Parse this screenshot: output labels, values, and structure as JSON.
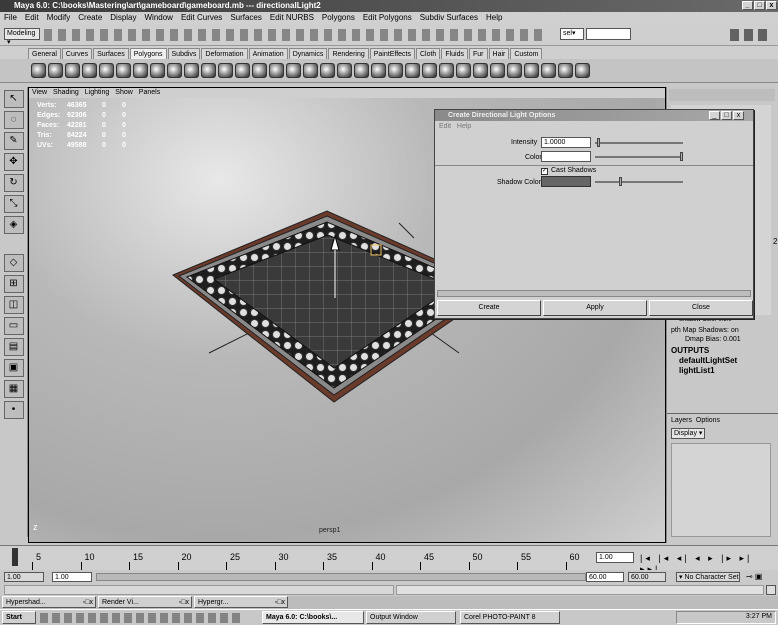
{
  "window": {
    "title": "Maya 6.0: C:\\books\\Mastering\\art\\gameboard\\gameboard.mb  ---  directionalLight2"
  },
  "menubar": [
    "File",
    "Edit",
    "Modify",
    "Create",
    "Display",
    "Window",
    "Edit Curves",
    "Surfaces",
    "Edit NURBS",
    "Polygons",
    "Edit Polygons",
    "Subdiv Surfaces",
    "Help"
  ],
  "statusline": {
    "mode": "Modeling",
    "selection_field": "sel▾"
  },
  "shelf_tabs": [
    "General",
    "Curves",
    "Surfaces",
    "Polygons",
    "Subdivs",
    "Deformation",
    "Animation",
    "Dynamics",
    "Rendering",
    "PaintEffects",
    "Cloth",
    "Fluids",
    "Fur",
    "Hair",
    "Custom"
  ],
  "shelf_active": "Polygons",
  "viewport": {
    "menu": [
      "View",
      "Shading",
      "Lighting",
      "Show",
      "Panels"
    ],
    "stats": [
      {
        "label": "Verts:",
        "v1": "46365",
        "v2": "0",
        "v3": "0"
      },
      {
        "label": "Edges:",
        "v1": "92306",
        "v2": "0",
        "v3": "0"
      },
      {
        "label": "Faces:",
        "v1": "42281",
        "v2": "0",
        "v3": "0"
      },
      {
        "label": "Tris:",
        "v1": "84224",
        "v2": "0",
        "v3": "0"
      },
      {
        "label": "UVs:",
        "v1": "49588",
        "v2": "0",
        "v3": "0"
      }
    ],
    "camera_label": "persp1",
    "axis_label": "z"
  },
  "dialog": {
    "title": "Create Directional Light Options",
    "menu": [
      "Edit",
      "Help"
    ],
    "intensity_label": "Intensity",
    "intensity_value": "1.0000",
    "color_label": "Color",
    "cast_shadows_label": "Cast Shadows",
    "shadow_color_label": "Shadow Color",
    "buttons": {
      "create": "Create",
      "apply": "Apply",
      "close": "Close"
    }
  },
  "right_panel": {
    "shadow_text": "Shadow Color  0.5.0",
    "dmap_shadows": "pth Map Shadows: on",
    "dmap_bias": "Dmap Bias: 0.001",
    "outputs_label": "OUTPUTS",
    "outputs": [
      "defaultLightSet",
      "lightList1"
    ],
    "layers_menu": [
      "Layers",
      "Options"
    ],
    "layer_display": "Display",
    "side_number": "2"
  },
  "timeline": {
    "ticks": [
      "5",
      "10",
      "15",
      "20",
      "25",
      "30",
      "35",
      "40",
      "45",
      "50",
      "55",
      "60"
    ],
    "current_frame": "1.00"
  },
  "range": {
    "start": "1.00",
    "inner_start": "1.00",
    "end_inner": "60.00",
    "end": "60.00",
    "character_set": "No Character Set"
  },
  "task_windows": [
    "Hypershad...",
    "Render Vi...",
    "Hypergr..."
  ],
  "taskbar": {
    "start": "Start",
    "items": [
      "Maya 6.0: C:\\books\\...",
      "Output Window",
      "Corel PHOTO-PAINT 8"
    ],
    "clock": "3:27 PM"
  }
}
